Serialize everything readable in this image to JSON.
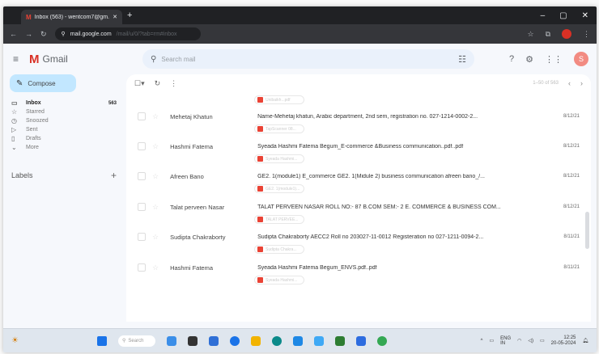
{
  "browser": {
    "tab_title": "Inbox (563) - wentcom7@gm...",
    "tab_close": "✕",
    "new_tab": "+",
    "url_host": "mail.google.com",
    "url_path": "/mail/u/0/?tab=rm#inbox",
    "window_controls": [
      "–",
      "▢",
      "✕"
    ]
  },
  "gmail": {
    "logo_text": "Gmail",
    "search_placeholder": "Search mail",
    "avatar_letter": "S",
    "compose_label": "Compose",
    "nav": [
      {
        "label": "Inbox",
        "count": "563",
        "icon": "inbox-icon",
        "active": true
      },
      {
        "label": "Starred",
        "count": "",
        "icon": "star-icon"
      },
      {
        "label": "Snoozed",
        "count": "",
        "icon": "clock-icon"
      },
      {
        "label": "Sent",
        "count": "",
        "icon": "send-icon"
      },
      {
        "label": "Drafts",
        "count": "",
        "icon": "draft-icon"
      },
      {
        "label": "More",
        "count": "",
        "icon": "chevron-down-icon"
      }
    ],
    "labels_heading": "Labels",
    "pagination": "1–50 of 563"
  },
  "emails": [
    {
      "sender": "",
      "subject": "",
      "date": "",
      "attachment": "Unibaikh...pdf"
    },
    {
      "sender": "Mehetaj Khatun",
      "subject": "Name-Mehetaj khatun, Arabic department, 2nd sem, registration no. 027-1214-0002-2...",
      "date": "8/12/21",
      "attachment": "TapScanner 08..."
    },
    {
      "sender": "Hashmi Fatema",
      "subject": "Syeada Hashmi Fatema Begum_E-commerce &Business communication..pdf..pdf",
      "date": "8/12/21",
      "attachment": "Syeada Hashmi..."
    },
    {
      "sender": "Afreen Bano",
      "subject": "GE2. 1(module1) E_commerce GE2. 1(Midule 2) business communication afreen bano_/...",
      "date": "8/12/21",
      "attachment": "GE2. 1(module1)..."
    },
    {
      "sender": "Talat perveen Nasar",
      "subject": "TALAT PERVEEN NASAR ROLL NO:- 87 B.COM SEM:- 2 E. COMMERCE & BUSINESS COM...",
      "date": "8/12/21",
      "attachment": "TALAT PERVEE..."
    },
    {
      "sender": "Sudipta Chakraborty",
      "subject": "Sudipta Chakraborty AECC2 Roll no 203027-11-0012 Registeration no 027-1211-0094-2...",
      "date": "8/11/21",
      "attachment": "Sudipta Chakra..."
    },
    {
      "sender": "Hashmi Fatema",
      "subject": "Syeada Hashmi Fatema Begum_ENVS.pdf..pdf",
      "date": "8/11/21",
      "attachment": "Syeada Hashmi..."
    }
  ],
  "taskbar": {
    "search_label": "Search",
    "language": "ENG\nIN",
    "time": "12:25",
    "date": "20-05-2024",
    "app_colors": [
      "#3b8ee8",
      "#333333",
      "#2f6fd6",
      "#1a73e8",
      "#f2b300",
      "#0b8a8a",
      "#1e88e5",
      "#3fa9f5",
      "#2e7d32",
      "#2d6cdf",
      "#34a853"
    ]
  }
}
